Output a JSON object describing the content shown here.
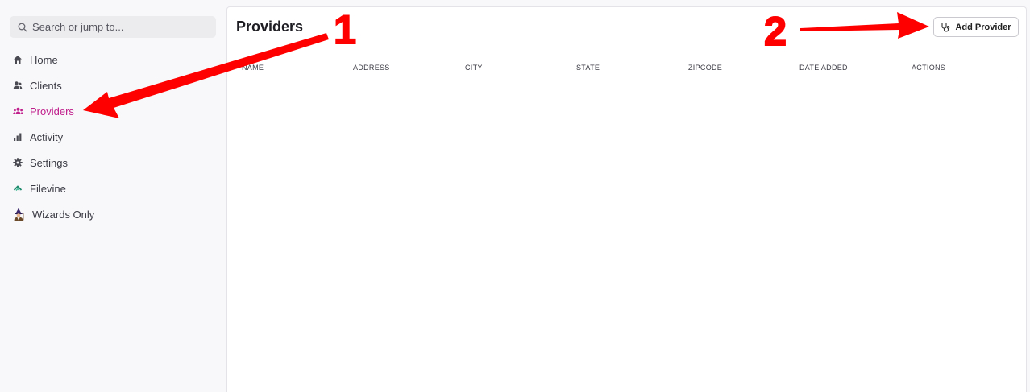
{
  "search": {
    "placeholder": "Search or jump to..."
  },
  "sidebar": {
    "items": [
      {
        "label": "Home",
        "icon": "home-icon"
      },
      {
        "label": "Clients",
        "icon": "users-icon"
      },
      {
        "label": "Providers",
        "icon": "group-icon",
        "active": true
      },
      {
        "label": "Activity",
        "icon": "bar-chart-icon"
      },
      {
        "label": "Settings",
        "icon": "gear-icon"
      },
      {
        "label": "Filevine",
        "icon": "filevine-logo-icon"
      },
      {
        "label": "Wizards Only",
        "icon": "wizard-icon"
      }
    ]
  },
  "main": {
    "title": "Providers",
    "add_button_label": "Add Provider",
    "columns": [
      "NAME",
      "ADDRESS",
      "CITY",
      "STATE",
      "ZIPCODE",
      "DATE ADDED",
      "ACTIONS"
    ],
    "rows": []
  },
  "annotations": {
    "step_1": "1",
    "step_2": "2",
    "color": "#ff0000"
  },
  "colors": {
    "accent": "#c0208c",
    "background": "#f8f8fa"
  }
}
